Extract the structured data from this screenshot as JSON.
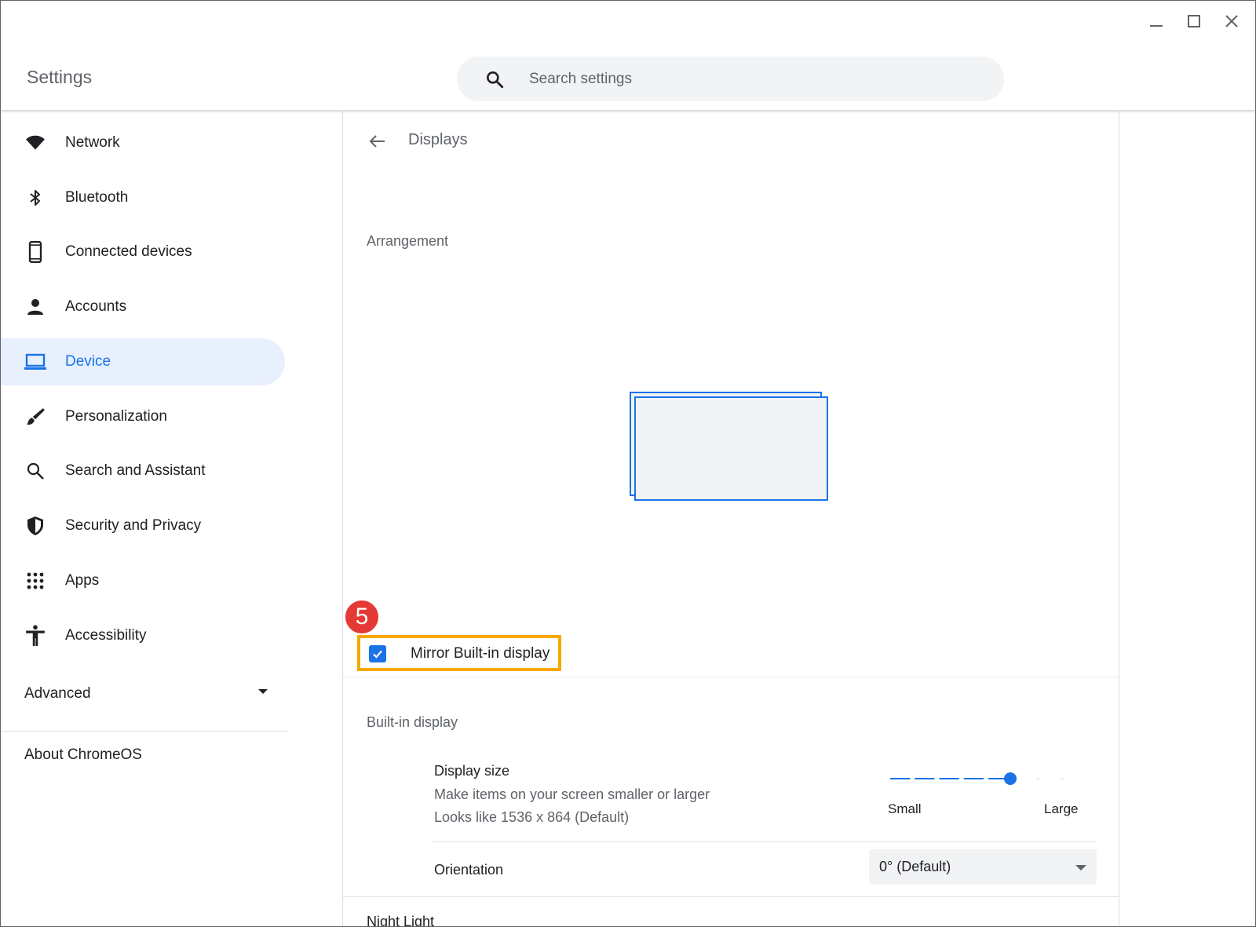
{
  "app": {
    "title": "Settings"
  },
  "search": {
    "placeholder": "Search settings",
    "icon": "search-icon"
  },
  "sidebar": {
    "items": [
      {
        "label": "Network",
        "icon": "wifi-icon"
      },
      {
        "label": "Bluetooth",
        "icon": "bluetooth-icon"
      },
      {
        "label": "Connected devices",
        "icon": "phone-icon"
      },
      {
        "label": "Accounts",
        "icon": "person-icon"
      },
      {
        "label": "Device",
        "icon": "laptop-icon",
        "active": true
      },
      {
        "label": "Personalization",
        "icon": "brush-icon"
      },
      {
        "label": "Search and Assistant",
        "icon": "search-icon"
      },
      {
        "label": "Security and Privacy",
        "icon": "shield-icon"
      },
      {
        "label": "Apps",
        "icon": "apps-grid-icon"
      },
      {
        "label": "Accessibility",
        "icon": "accessibility-icon"
      }
    ],
    "advanced_label": "Advanced",
    "about_label": "About ChromeOS"
  },
  "page": {
    "title": "Displays",
    "arrangement_heading": "Arrangement",
    "step_badge": "5",
    "mirror_label": "Mirror Built-in display",
    "mirror_checked": true,
    "builtin_heading": "Built-in display",
    "display_size": {
      "title": "Display size",
      "subtitle": "Make items on your screen smaller or larger",
      "resolution": "Looks like 1536 x 864 (Default)",
      "min_label": "Small",
      "max_label": "Large",
      "steps": 9,
      "selected_step": 5
    },
    "orientation": {
      "label": "Orientation",
      "value": "0° (Default)"
    },
    "night_light_heading": "Night Light"
  },
  "colors": {
    "accent": "#1a73e8",
    "active_nav_bg": "#e8f0fe",
    "highlight_border": "#f5a800",
    "badge": "#e53935"
  }
}
